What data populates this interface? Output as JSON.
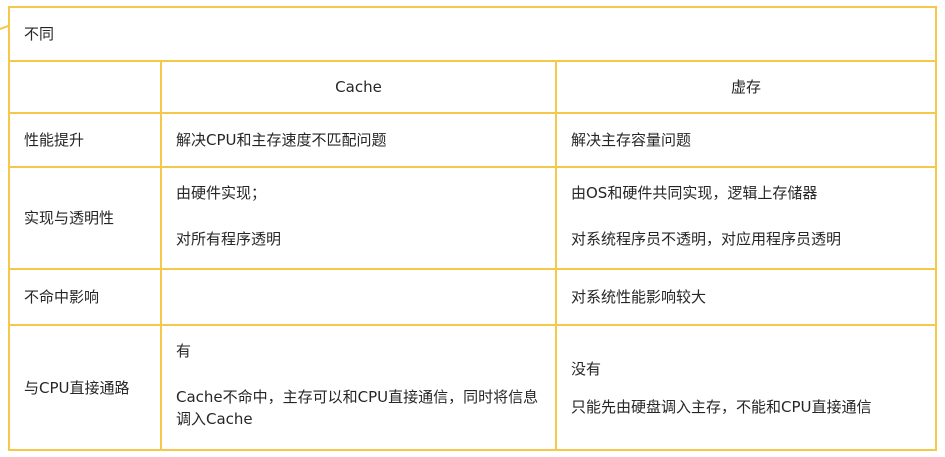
{
  "table": {
    "title": "不同",
    "header": [
      "",
      "Cache",
      "虚存"
    ],
    "rows": [
      {
        "label": "性能提升",
        "cache": [
          "解决CPU和主存速度不匹配问题"
        ],
        "vm": [
          "解决主存容量问题"
        ]
      },
      {
        "label": "实现与透明性",
        "cache": [
          "由硬件实现；",
          "对所有程序透明"
        ],
        "vm": [
          "由OS和硬件共同实现，逻辑上存储器",
          "对系统程序员不透明，对应用程序员透明"
        ]
      },
      {
        "label": "不命中影响",
        "cache": [],
        "vm": [
          "对系统性能影响较大"
        ]
      },
      {
        "label": "与CPU直接通路",
        "cache": [
          "有",
          "Cache不命中，主存可以和CPU直接通信，同时将信息调入Cache"
        ],
        "vm": [
          "没有",
          "只能先由硬盘调入主存，不能和CPU直接通信"
        ]
      }
    ]
  },
  "colors": {
    "border": "#f5c84a",
    "text": "#262626",
    "background": "#ffffff"
  }
}
